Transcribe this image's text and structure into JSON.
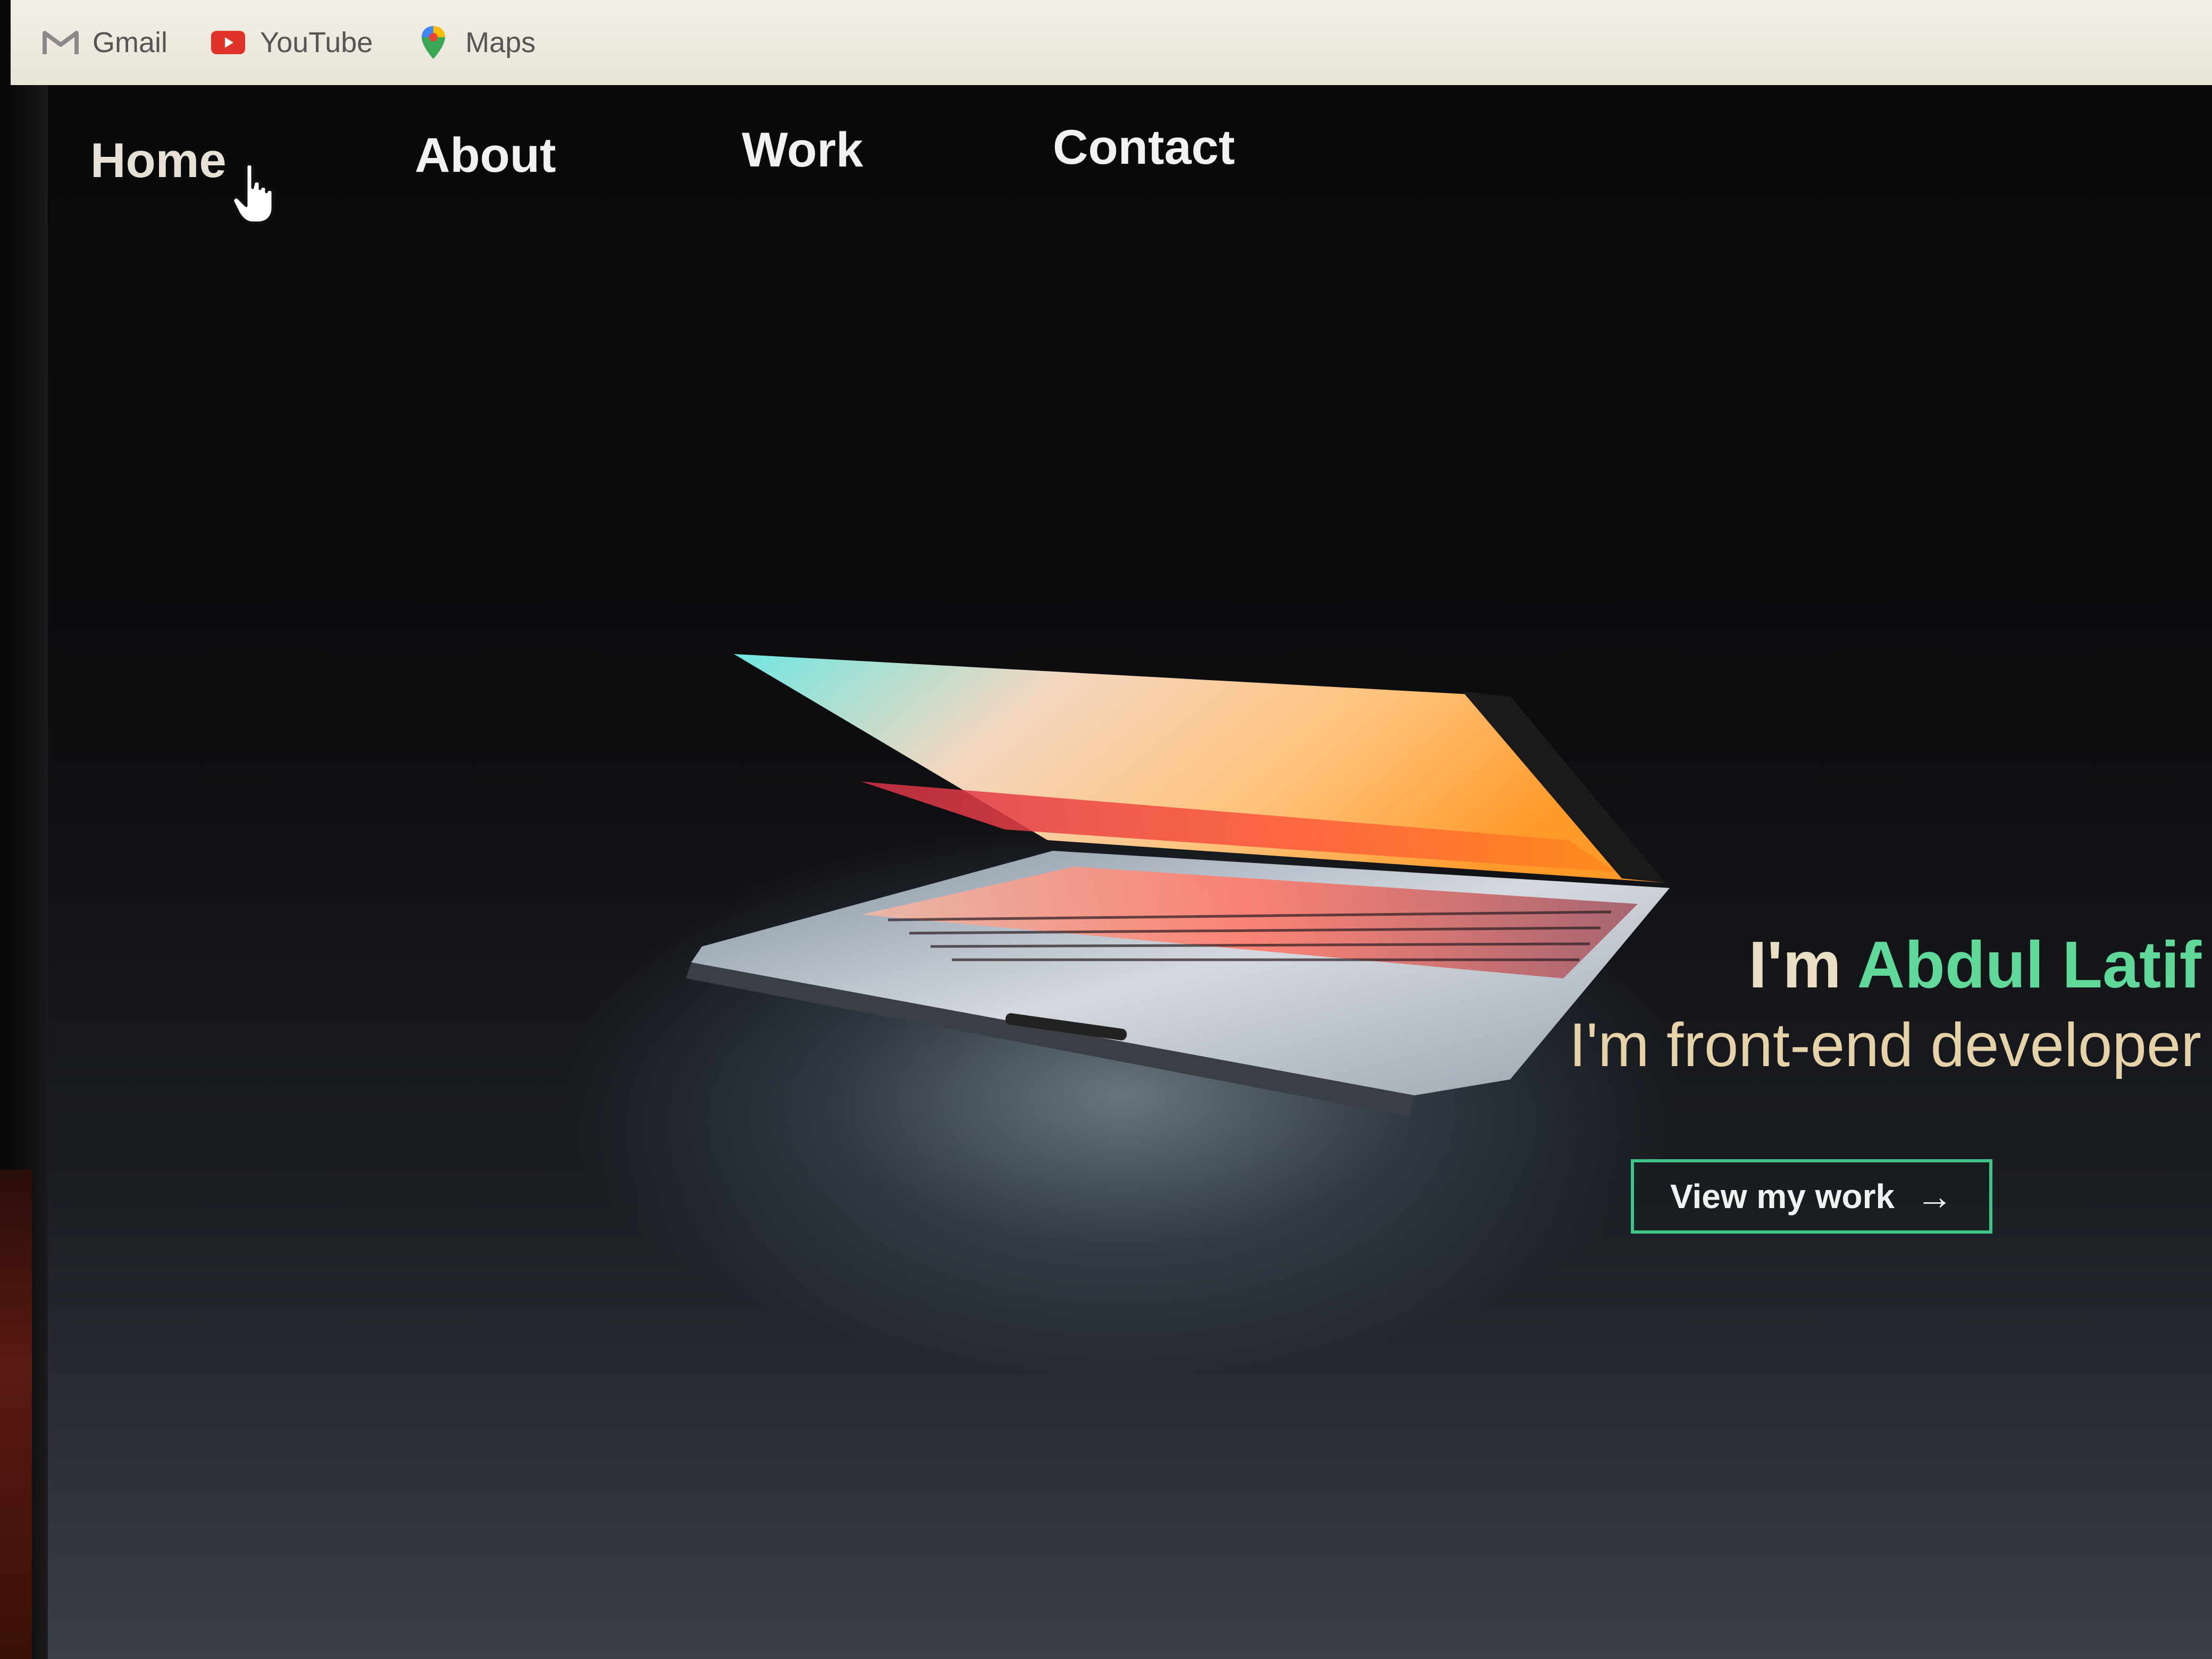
{
  "bookmarks": {
    "items": [
      {
        "label": "Gmail",
        "icon": "gmail-icon"
      },
      {
        "label": "YouTube",
        "icon": "youtube-icon"
      },
      {
        "label": "Maps",
        "icon": "maps-icon"
      }
    ]
  },
  "nav": {
    "items": [
      {
        "label": "Home"
      },
      {
        "label": "About"
      },
      {
        "label": "Work"
      },
      {
        "label": "Contact"
      }
    ]
  },
  "hero": {
    "intro": "I'm ",
    "name": "Abdul Latif",
    "tagline": "I'm front-end developer",
    "cta_label": "View my work",
    "cta_arrow": "→"
  },
  "colors": {
    "accent_green": "#5fd89a",
    "button_border": "#40c486",
    "background": "#0b0b0d"
  }
}
